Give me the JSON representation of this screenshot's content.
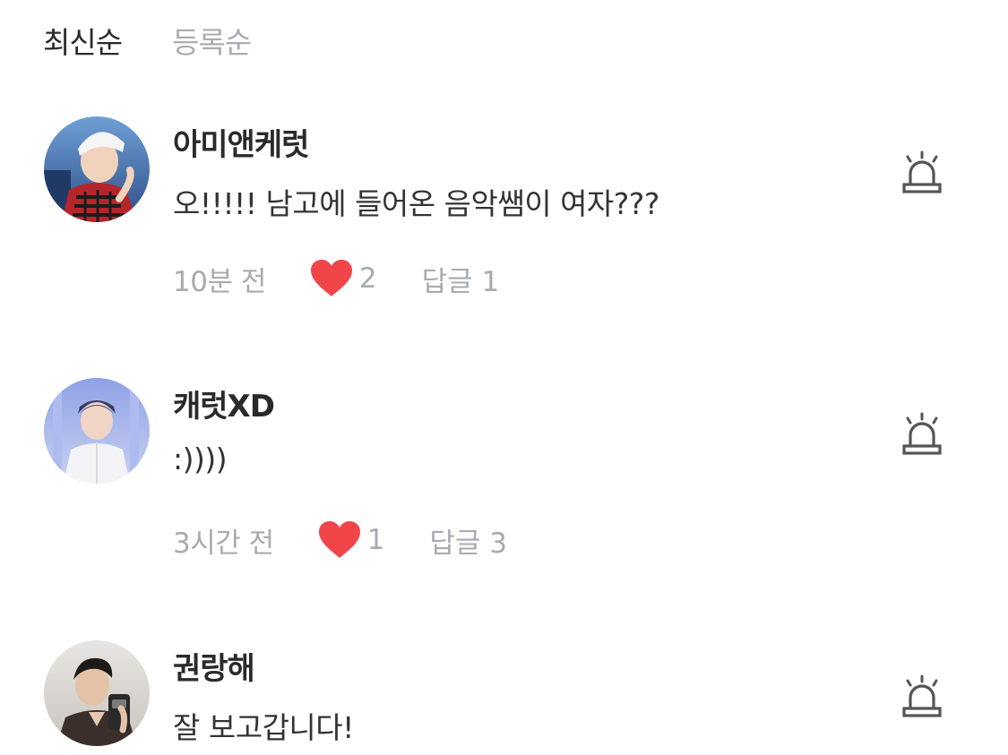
{
  "sort": {
    "latest_label": "최신순",
    "registered_label": "등록순",
    "active": "latest"
  },
  "comments": [
    {
      "author": "아미앤케럿",
      "text": "오!!!!! 남고에 들어온 음악쌤이 여자???",
      "time": "10분 전",
      "likes": "2",
      "replies": "답글 1"
    },
    {
      "author": "캐럿XD",
      "text": ":))))",
      "time": "3시간 전",
      "likes": "1",
      "replies": "답글 3"
    },
    {
      "author": "권랑해",
      "text": "잘 보고갑니다!",
      "time": "",
      "likes": "",
      "replies": ""
    }
  ],
  "colors": {
    "heart": "#f1454a",
    "meta_text": "#a7abb1",
    "icon_stroke": "#555555"
  }
}
